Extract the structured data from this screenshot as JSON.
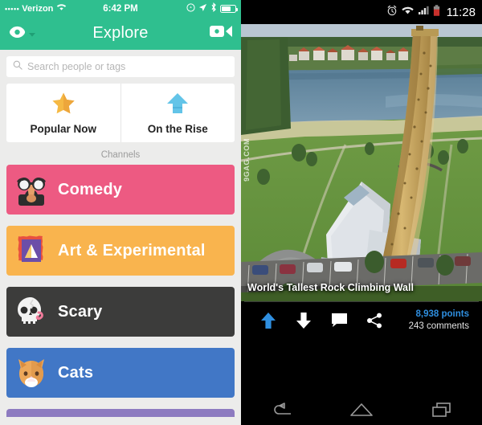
{
  "left_app": {
    "status_bar": {
      "signal_dots": "•••••",
      "carrier": "Verizon",
      "time": "6:42 PM",
      "icons": [
        "rotation-lock-icon",
        "location-arrow-icon",
        "bluetooth-icon",
        "battery-icon"
      ]
    },
    "navbar": {
      "logo": "eye-logo-icon",
      "dropdown": "chevron-down-icon",
      "title": "Explore",
      "action": "video-camera-icon"
    },
    "search": {
      "icon": "search-icon",
      "placeholder": "Search people or tags",
      "value": ""
    },
    "quick_actions": [
      {
        "label": "Popular Now",
        "icon": "star-icon",
        "color": "#F5B944"
      },
      {
        "label": "On the Rise",
        "icon": "up-arrow-icon",
        "color": "#63C4E8"
      }
    ],
    "channels_header": "Channels",
    "channels": [
      {
        "label": "Comedy",
        "color": "#ED5A82",
        "icon": "groucho-glasses-icon"
      },
      {
        "label": "Art & Experimental",
        "color": "#F9B44E",
        "icon": "framed-painting-icon"
      },
      {
        "label": "Scary",
        "color": "#3C3C3B",
        "icon": "skull-icon"
      },
      {
        "label": "Cats",
        "color": "#4177C6",
        "icon": "cat-face-icon"
      },
      {
        "label": "",
        "color": "#8D7BC0",
        "icon": ""
      }
    ],
    "colors": {
      "accent": "#2FBF8F",
      "background": "#ECECEB"
    }
  },
  "right_app": {
    "status_bar": {
      "time": "11:28",
      "icons": [
        "alarm-clock-icon",
        "wifi-icon",
        "cell-signal-icon",
        "battery-low-icon"
      ],
      "battery_color": "#C9302C"
    },
    "post": {
      "caption": "World's Tallest Rock Climbing Wall",
      "watermark": "9GAG.COM"
    },
    "actions": [
      {
        "name": "upvote-button",
        "icon": "up-arrow-icon",
        "color": "#2F8FE0"
      },
      {
        "name": "downvote-button",
        "icon": "down-arrow-icon",
        "color": "#FFFFFF"
      },
      {
        "name": "comment-button",
        "icon": "comment-bubble-icon",
        "color": "#FFFFFF"
      },
      {
        "name": "share-button",
        "icon": "share-icon",
        "color": "#FFFFFF"
      }
    ],
    "stats": {
      "points": "8,938 points",
      "comments": "243 comments"
    },
    "nav_bar": [
      "back-icon",
      "home-icon",
      "recent-apps-icon"
    ],
    "colors": {
      "accent": "#2F8FE0",
      "background": "#000000"
    }
  }
}
